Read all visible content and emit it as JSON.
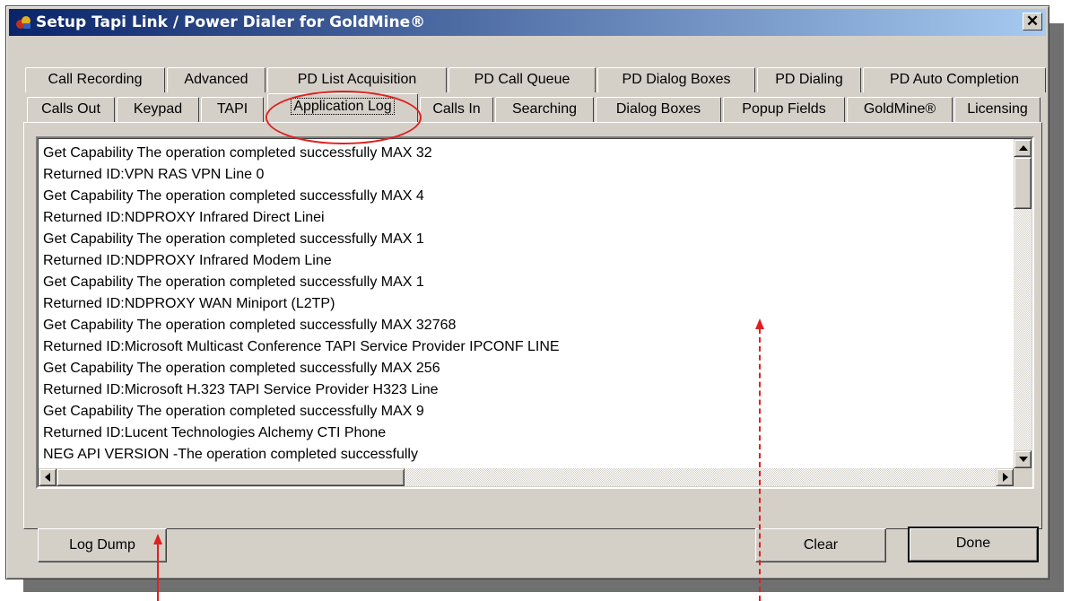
{
  "window": {
    "title": "Setup Tapi Link / Power Dialer for GoldMine®",
    "close_glyph": "✕"
  },
  "tabs": {
    "row1": [
      "Call Recording",
      "Advanced",
      "PD List Acquisition",
      "PD Call Queue",
      "PD Dialog Boxes",
      "PD Dialing",
      "PD Auto Completion"
    ],
    "row2": [
      "Calls Out",
      "Keypad",
      "TAPI",
      "Application Log",
      "Calls In",
      "Searching",
      "Dialog Boxes",
      "Popup Fields",
      "GoldMine®",
      "Licensing"
    ],
    "active": "Application Log"
  },
  "log": {
    "lines": [
      "Get Capability The operation completed successfully MAX 32",
      "Returned ID:VPN RAS VPN Line 0",
      "Get Capability The operation completed successfully MAX 4",
      "Returned ID:NDPROXY Infrared Direct Linei",
      "Get Capability The operation completed successfully MAX 1",
      "Returned ID:NDPROXY Infrared Modem Line",
      "Get Capability The operation completed successfully MAX 1",
      "Returned ID:NDPROXY WAN Miniport (L2TP)",
      "Get Capability The operation completed successfully MAX 32768",
      "Returned ID:Microsoft Multicast Conference TAPI Service Provider IPCONF LINE",
      "Get Capability The operation completed successfully MAX 256",
      "Returned ID:Microsoft H.323 TAPI Service Provider H323 Line",
      "Get Capability The operation completed successfully MAX 9",
      "Returned ID:Lucent Technologies Alchemy CTI Phone",
      "NEG API VERSION -The operation completed successfully"
    ]
  },
  "buttons": {
    "log_dump": "Log Dump",
    "clear": "Clear",
    "done": "Done"
  },
  "colors": {
    "titlebar_start": "#0a246a",
    "titlebar_end": "#a6caf0",
    "annotation": "#e02020",
    "face": "#d4d0c8"
  }
}
